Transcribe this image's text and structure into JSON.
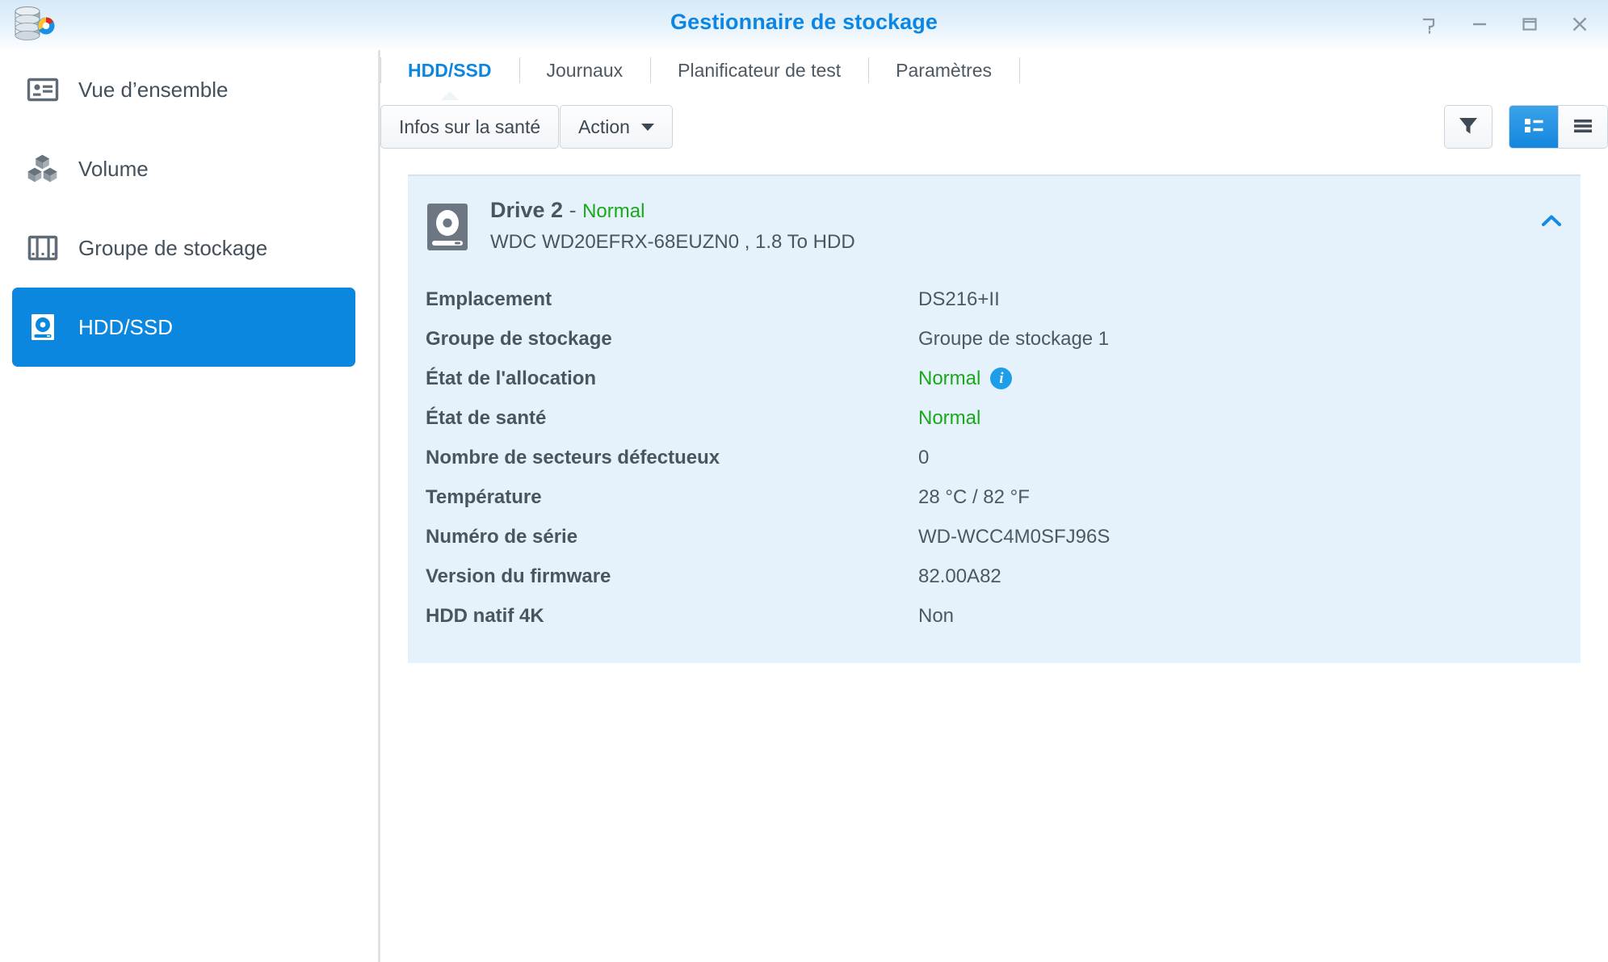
{
  "window": {
    "title": "Gestionnaire de stockage",
    "app_icon": "storage-manager-icon",
    "controls": [
      {
        "name": "help-button",
        "icon": "question-mark-icon",
        "label": "?"
      },
      {
        "name": "minimize-button",
        "icon": "minimize-icon",
        "label": "—"
      },
      {
        "name": "maximize-button",
        "icon": "maximize-icon",
        "label": "□"
      },
      {
        "name": "close-button",
        "icon": "close-icon",
        "label": "✕"
      }
    ]
  },
  "sidebar": {
    "items": [
      {
        "label": "Vue d’ensemble",
        "icon": "overview-card-icon",
        "active": false
      },
      {
        "label": "Volume",
        "icon": "volume-cubes-icon",
        "active": false
      },
      {
        "label": "Groupe de stockage",
        "icon": "storage-pool-icon",
        "active": false
      },
      {
        "label": "HDD/SSD",
        "icon": "hard-drive-icon",
        "active": true
      }
    ]
  },
  "tabs": [
    {
      "label": "HDD/SSD",
      "active": true
    },
    {
      "label": "Journaux",
      "active": false
    },
    {
      "label": "Planificateur de test",
      "active": false
    },
    {
      "label": "Paramètres",
      "active": false
    }
  ],
  "toolbar": {
    "health_info_label": "Infos sur la santé",
    "action_label": "Action",
    "filter_icon": "filter-funnel-icon",
    "view_detail_icon": "detail-view-icon",
    "view_list_icon": "list-view-icon"
  },
  "drive": {
    "name": "Drive 2",
    "separator": "-",
    "status": "Normal",
    "model": "WDC WD20EFRX-68EUZN0 , 1.8 To HDD",
    "collapse_icon": "chevron-up-icon",
    "details": [
      {
        "label": "Emplacement",
        "value": "DS216+II",
        "green": false,
        "info": false
      },
      {
        "label": "Groupe de stockage",
        "value": "Groupe de stockage 1",
        "green": false,
        "info": false
      },
      {
        "label": "État de l'allocation",
        "value": "Normal",
        "green": true,
        "info": true
      },
      {
        "label": "État de santé",
        "value": "Normal",
        "green": true,
        "info": false
      },
      {
        "label": "Nombre de secteurs défectueux",
        "value": "0",
        "green": false,
        "info": false
      },
      {
        "label": "Température",
        "value": "28 °C / 82 °F",
        "green": false,
        "info": false
      },
      {
        "label": "Numéro de série",
        "value": "WD-WCC4M0SFJ96S",
        "green": false,
        "info": false
      },
      {
        "label": "Version du firmware",
        "value": "82.00A82",
        "green": false,
        "info": false
      },
      {
        "label": "HDD natif 4K",
        "value": "Non",
        "green": false,
        "info": false
      }
    ]
  },
  "colors": {
    "accent": "#0c87e0",
    "status_ok": "#19a819",
    "panel_bg": "#e5f2fc",
    "text": "#4a555f"
  }
}
